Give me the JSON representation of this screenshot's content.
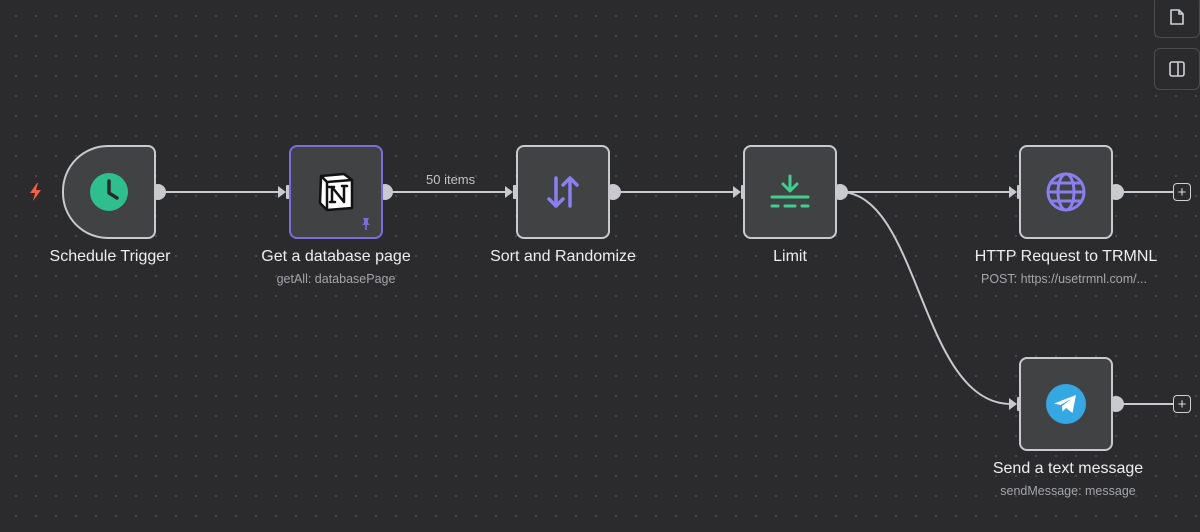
{
  "canvas": {
    "background": "#2b2b2d",
    "connection_color": "#c9cad0"
  },
  "nodes": {
    "schedule_trigger": {
      "title": "Schedule Trigger",
      "subtitle": "",
      "icon": "clock-icon",
      "icon_color": "#2fbf8f"
    },
    "get_database_page": {
      "title": "Get a database page",
      "subtitle": "getAll: databasePage",
      "icon": "notion-icon",
      "pinned": true,
      "selected": true
    },
    "sort_randomize": {
      "title": "Sort and Randomize",
      "subtitle": "",
      "icon": "sort-arrows-icon",
      "icon_color": "#8b7ff0"
    },
    "limit": {
      "title": "Limit",
      "subtitle": "",
      "icon": "limit-icon",
      "icon_color": "#3fcf8e"
    },
    "http_request": {
      "title": "HTTP Request to TRMNL",
      "subtitle": "POST: https://usetrmnl.com/...",
      "icon": "globe-icon",
      "icon_color": "#8b7ff0"
    },
    "send_text_message": {
      "title": "Send a text message",
      "subtitle": "sendMessage: message",
      "icon": "telegram-icon",
      "icon_color": "#35a7e3"
    }
  },
  "edges": {
    "items_label": "50 items"
  },
  "controls": {
    "plus_symbol": "+",
    "side_buttons": [
      "sticky-note-icon",
      "panel-toggle-icon"
    ]
  }
}
